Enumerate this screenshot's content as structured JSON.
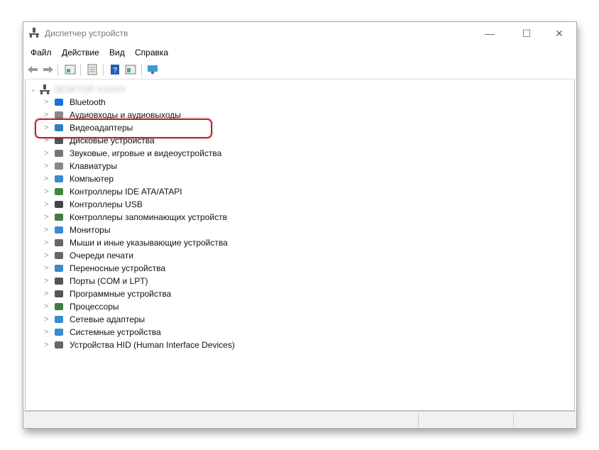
{
  "window": {
    "title": "Диспетчер устройств",
    "minimize": "—",
    "maximize": "☐",
    "close": "✕"
  },
  "menu": [
    "Файл",
    "Действие",
    "Вид",
    "Справка"
  ],
  "toolbar": [
    "back-icon",
    "forward-icon",
    "properties-icon",
    "view-icon",
    "help-icon",
    "update-driver-icon",
    "monitor-scan-icon"
  ],
  "tree": {
    "root": "DESKTOP-XXXXX",
    "items": [
      {
        "label": "Bluetooth",
        "icon": "bluetooth-icon",
        "color": "#1a73d9"
      },
      {
        "label": "Аудиовходы и аудиовыходы",
        "icon": "audio-icon",
        "color": "#888888"
      },
      {
        "label": "Видеоадаптеры",
        "icon": "display-adapter-icon",
        "color": "#2d7fc1"
      },
      {
        "label": "Дисковые устройства",
        "icon": "disk-icon",
        "color": "#555555"
      },
      {
        "label": "Звуковые, игровые и видеоустройства",
        "icon": "speaker-icon",
        "color": "#777777"
      },
      {
        "label": "Клавиатуры",
        "icon": "keyboard-icon",
        "color": "#888888"
      },
      {
        "label": "Компьютер",
        "icon": "computer-icon",
        "color": "#3a8bd0"
      },
      {
        "label": "Контроллеры IDE ATA/ATAPI",
        "icon": "ide-icon",
        "color": "#3f8a3f"
      },
      {
        "label": "Контроллеры USB",
        "icon": "usb-icon",
        "color": "#444444"
      },
      {
        "label": "Контроллеры запоминающих устройств",
        "icon": "storage-icon",
        "color": "#4a7a4a"
      },
      {
        "label": "Мониторы",
        "icon": "monitor-icon",
        "color": "#3a8bd0"
      },
      {
        "label": "Мыши и иные указывающие устройства",
        "icon": "mouse-icon",
        "color": "#666666"
      },
      {
        "label": "Очереди печати",
        "icon": "printer-icon",
        "color": "#666666"
      },
      {
        "label": "Переносные устройства",
        "icon": "portable-icon",
        "color": "#3a8bd0"
      },
      {
        "label": "Порты (COM и LPT)",
        "icon": "port-icon",
        "color": "#555555"
      },
      {
        "label": "Программные устройства",
        "icon": "software-device-icon",
        "color": "#555555"
      },
      {
        "label": "Процессоры",
        "icon": "cpu-icon",
        "color": "#3f7a3f"
      },
      {
        "label": "Сетевые адаптеры",
        "icon": "network-icon",
        "color": "#3a8bd0"
      },
      {
        "label": "Системные устройства",
        "icon": "system-icon",
        "color": "#3a8bd0"
      },
      {
        "label": "Устройства HID (Human Interface Devices)",
        "icon": "hid-icon",
        "color": "#666666"
      }
    ]
  },
  "highlight_color": "#c9202a"
}
